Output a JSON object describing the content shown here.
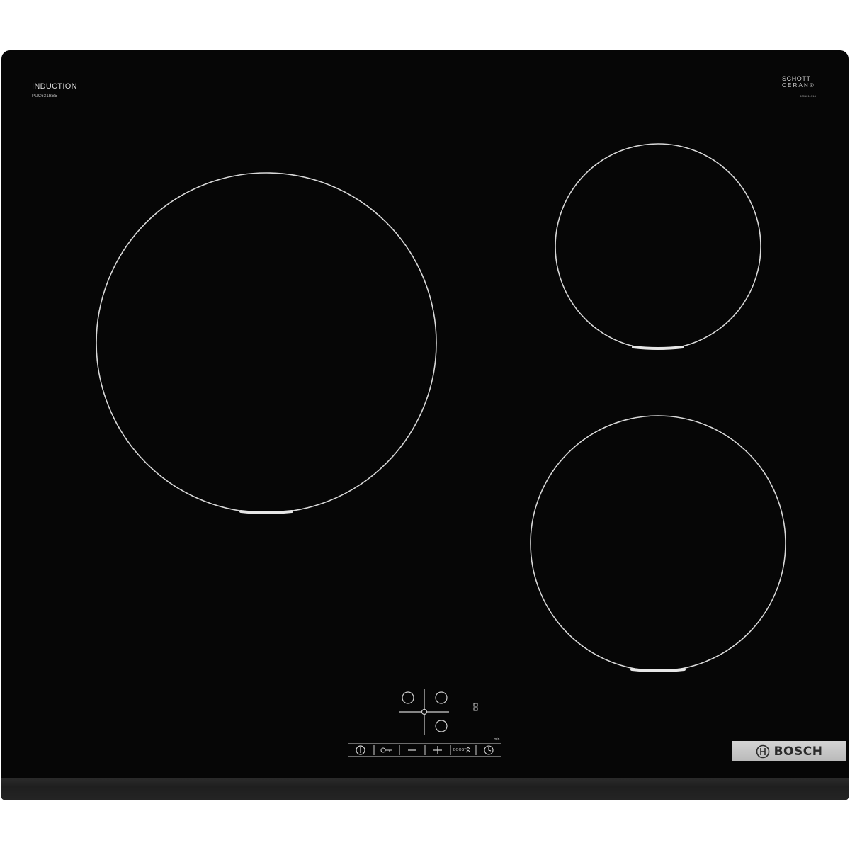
{
  "product": {
    "type_label": "INDUCTION",
    "model": "PUC631BB5",
    "glass_brand_line1": "SCHOTT",
    "glass_brand_line2": "CERAN®",
    "glass_code": "8001211514",
    "brand": "BOSCH"
  },
  "controls": {
    "boost_label": "BOOST",
    "min_label": "min",
    "keys": [
      {
        "name": "power-key",
        "icon": "power-icon"
      },
      {
        "name": "lock-key",
        "icon": "key-icon"
      },
      {
        "name": "minus-key",
        "icon": "minus-icon"
      },
      {
        "name": "plus-key",
        "icon": "plus-icon"
      },
      {
        "name": "boost-key",
        "icon": "double-chevron-up-icon"
      },
      {
        "name": "timer-key",
        "icon": "clock-icon"
      }
    ]
  },
  "colors": {
    "glass": "#060606",
    "zone_outline": "#d8d8d8",
    "badge": "#c6c6c6"
  }
}
